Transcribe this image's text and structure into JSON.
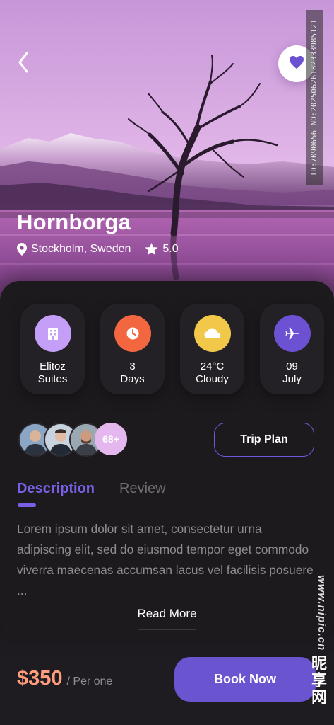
{
  "place": {
    "name": "Hornborga",
    "location": "Stockholm, Sweden",
    "rating": "5.0"
  },
  "info_tiles": [
    {
      "line1": "Elitoz",
      "line2": "Suites",
      "icon": "hotel-icon",
      "color": "#c59ef7"
    },
    {
      "line1": "3",
      "line2": "Days",
      "icon": "clock-icon",
      "color": "#f2673f"
    },
    {
      "line1": "24°C",
      "line2": "Cloudy",
      "icon": "cloud-icon",
      "color": "#f2c84b"
    },
    {
      "line1": "09",
      "line2": "July",
      "icon": "plane-icon",
      "color": "#6c52d3"
    }
  ],
  "travelers": {
    "more_count": "68+"
  },
  "buttons": {
    "trip_plan": "Trip Plan",
    "book_now": "Book Now",
    "read_more": "Read More"
  },
  "tabs": {
    "description": "Description",
    "review": "Review",
    "active": "Description"
  },
  "description_text": "Lorem ipsum dolor sit amet, consectetur urna adipiscing elit, sed do eiusmod tempor eget commodo viverra maecenas accumsan lacus vel facilisis posuere ...",
  "price": {
    "amount": "$350",
    "unit": "/ Per one"
  },
  "watermark": {
    "id_text": "ID:7090656 NO:20250626182333985121",
    "site": "www.nipic.cn",
    "brand": "昵享网"
  },
  "colors": {
    "accent": "#7b5fe6",
    "price": "#ff9d7d",
    "card_bg": "#1c1a1d",
    "favorite_heart": "#6c52d3"
  }
}
